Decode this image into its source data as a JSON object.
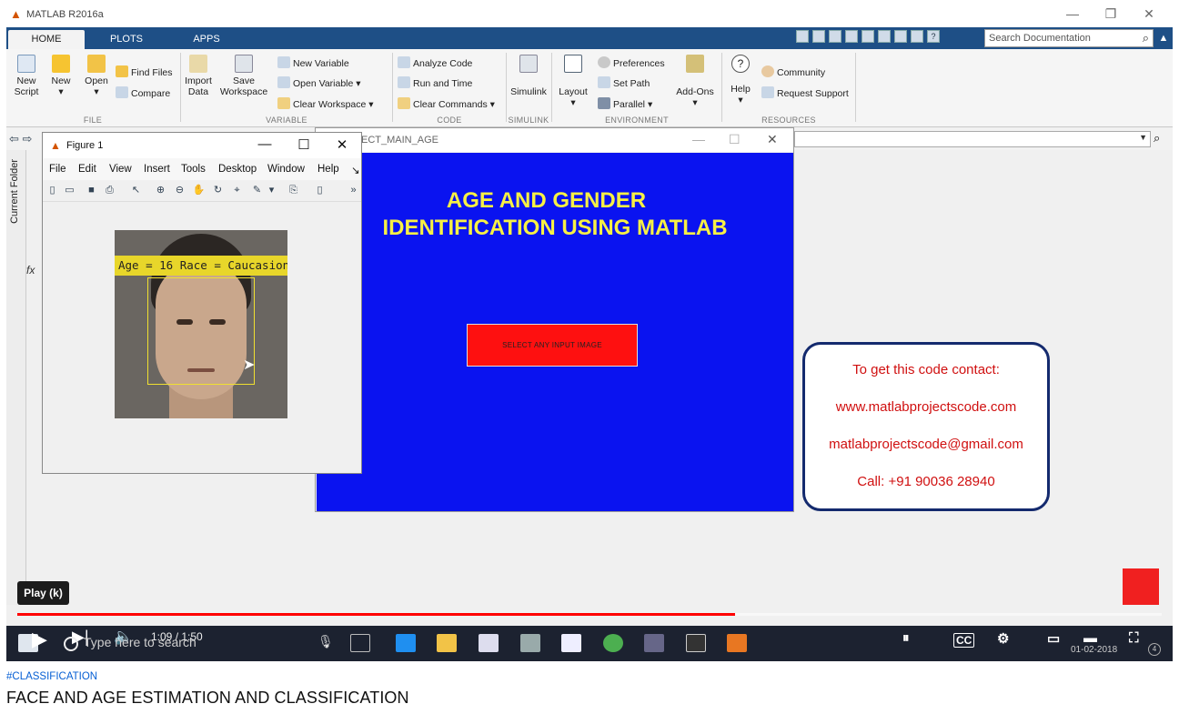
{
  "matlab": {
    "window_title": "MATLAB R2016a",
    "tabs": [
      "HOME",
      "PLOTS",
      "APPS"
    ],
    "search_placeholder": "Search Documentation",
    "ribbon": {
      "file": {
        "new_script": "New\nScript",
        "new": "New",
        "open": "Open",
        "find_files": "Find Files",
        "compare": "Compare",
        "label": "FILE"
      },
      "variable": {
        "import_data": "Import\nData",
        "save_workspace": "Save\nWorkspace",
        "new_variable": "New Variable",
        "open_variable": "Open Variable",
        "clear_workspace": "Clear Workspace",
        "label": "VARIABLE"
      },
      "code": {
        "analyze_code": "Analyze Code",
        "run_and_time": "Run and Time",
        "clear_commands": "Clear Commands",
        "label": "CODE"
      },
      "simulink": {
        "simulink": "Simulink",
        "label": "SIMULINK"
      },
      "environment": {
        "layout": "Layout",
        "preferences": "Preferences",
        "set_path": "Set Path",
        "parallel": "Parallel",
        "add_ons": "Add-Ons",
        "label": "ENVIRONMENT"
      },
      "resources": {
        "help": "Help",
        "community": "Community",
        "request_support": "Request Support",
        "label": "RESOURCES"
      }
    },
    "current_folder_label": "Current Folder",
    "fx_label": "fx"
  },
  "app_window": {
    "title": "ECT_MAIN_AGE",
    "heading_line1": "AGE AND GENDER",
    "heading_line2": "IDENTIFICATION USING MATLAB",
    "select_button": "SELECT ANY INPUT IMAGE",
    "canvas_color": "#0a13f0",
    "heading_color": "#f7f045",
    "button_color": "#fe1010"
  },
  "figure": {
    "title": "Figure 1",
    "menu": [
      "File",
      "Edit",
      "View",
      "Insert",
      "Tools",
      "Desktop",
      "Window",
      "Help"
    ],
    "overflow_glyph": "»",
    "age_label": "Age = 16 Race = Caucasion"
  },
  "contact": {
    "line1": "To get this code contact:",
    "line2": "www.matlabprojectscode.com",
    "line3": "matlabprojectscode@gmail.com",
    "line4": "Call: +91 90036 28940",
    "text_color": "#d01010",
    "border_color": "#142a6e"
  },
  "player": {
    "tooltip": "Play (k)",
    "time": "1:09 / 1:50",
    "progress_fraction": 0.6273,
    "progress_color": "#ff0000",
    "cc_label": "CC"
  },
  "taskbar": {
    "search_text": "Type here to search",
    "date": "01-02-2018",
    "notification_count": "4"
  },
  "page": {
    "hashtag": "#CLASSIFICATION",
    "video_title": "FACE AND AGE ESTIMATION AND CLASSIFICATION"
  }
}
